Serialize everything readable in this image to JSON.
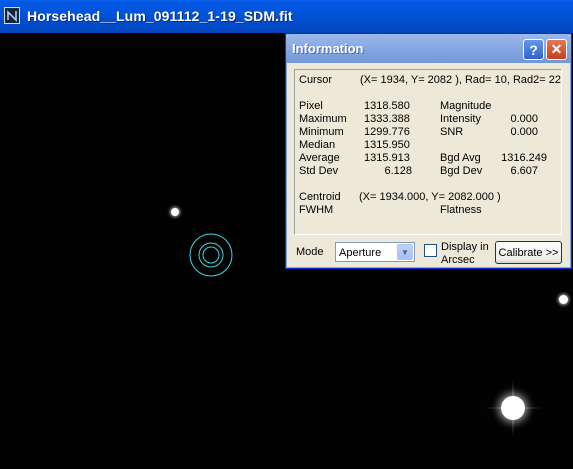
{
  "main_window": {
    "title": "Horsehead__Lum_091112_1-19_SDM.fit"
  },
  "info_window": {
    "title": "Information",
    "help_label": "?",
    "close_label": "✕",
    "cursor": {
      "label": "Cursor",
      "value": "(X= 1934, Y= 2082 ), Rad= 10, Rad2= 22"
    },
    "stats": {
      "pixel": {
        "label": "Pixel",
        "value": "1318.580"
      },
      "maximum": {
        "label": "Maximum",
        "value": "1333.388"
      },
      "minimum": {
        "label": "Minimum",
        "value": "1299.776"
      },
      "median": {
        "label": "Median",
        "value": "1315.950"
      },
      "average": {
        "label": "Average",
        "value": "1315.913"
      },
      "std_dev": {
        "label": "Std Dev",
        "value": "6.128"
      },
      "magnitude": {
        "label": "Magnitude",
        "value": ""
      },
      "intensity": {
        "label": "Intensity",
        "value": "0.000"
      },
      "snr": {
        "label": "SNR",
        "value": "0.000"
      },
      "bgd_avg": {
        "label": "Bgd Avg",
        "value": "1316.249"
      },
      "bgd_dev": {
        "label": "Bgd Dev",
        "value": "6.607"
      }
    },
    "centroid": {
      "label": "Centroid",
      "value": "(X= 1934.000, Y= 2082.000 )"
    },
    "fwhm": {
      "label": "FWHM",
      "value": ""
    },
    "flatness": {
      "label": "Flatness",
      "value": ""
    },
    "mode": {
      "label": "Mode",
      "selected": "Aperture"
    },
    "arcsec": {
      "label_line1": "Display in",
      "label_line2": "Arcsec",
      "checked": false
    },
    "calibrate_label": "Calibrate >>"
  },
  "colors": {
    "aperture_ring": "#3fd6e0",
    "titlebar_blue": "#0254d8"
  },
  "icons": [
    "app-icon",
    "help-icon",
    "close-icon",
    "chevron-down-icon"
  ]
}
